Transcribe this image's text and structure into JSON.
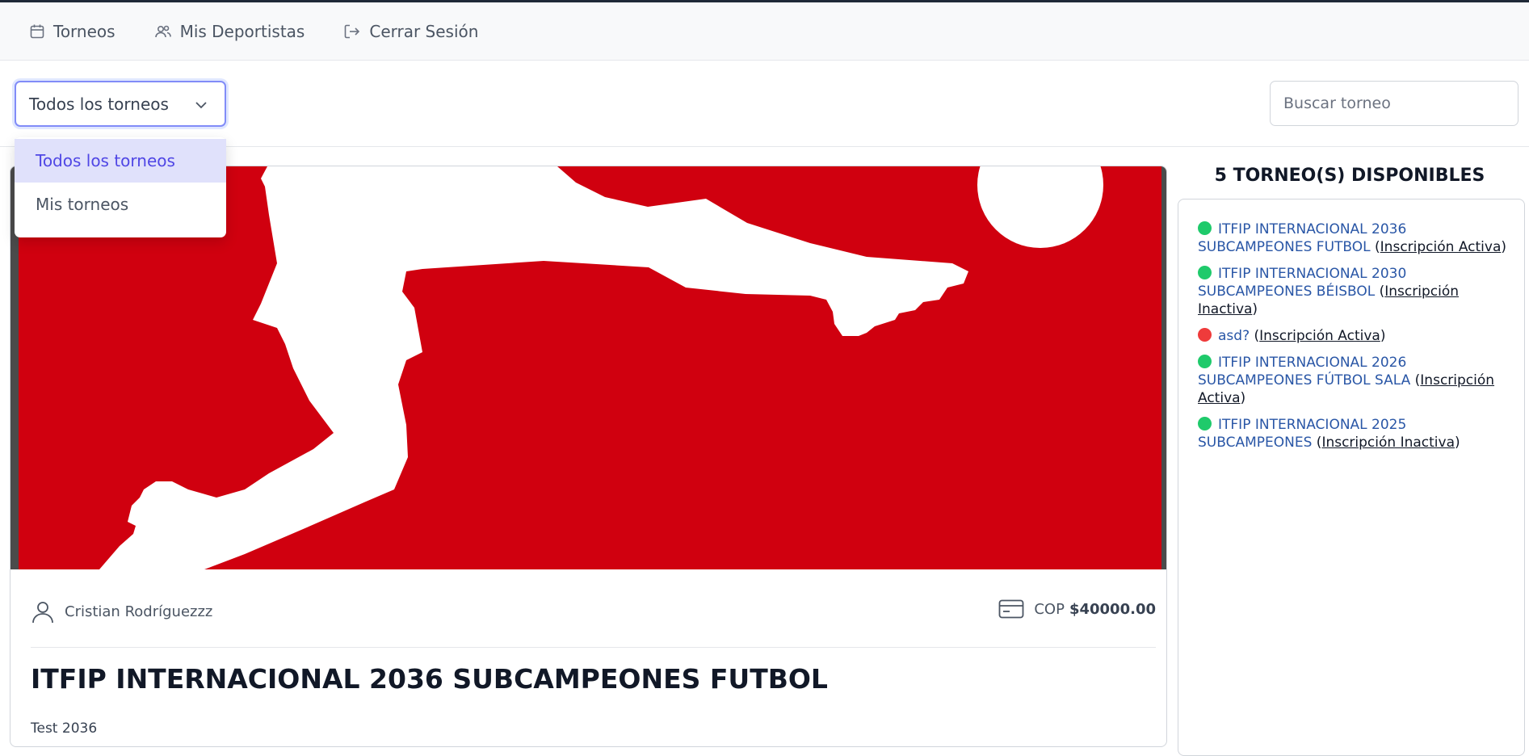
{
  "nav": {
    "items": [
      {
        "label": "Torneos",
        "icon": "calendar-icon"
      },
      {
        "label": "Mis Deportistas",
        "icon": "users-icon"
      },
      {
        "label": "Cerrar Sesión",
        "icon": "logout-icon"
      }
    ]
  },
  "filter": {
    "selected": "Todos los torneos",
    "options": [
      "Todos los torneos",
      "Mis torneos"
    ],
    "search_placeholder": "Buscar torneo"
  },
  "card": {
    "author": "Cristian Rodríguezzz",
    "currency": "COP",
    "price": "$40000.00",
    "title": "ITFIP INTERNACIONAL 2036 SUBCAMPEONES FUTBOL",
    "description": "Test 2036"
  },
  "sidebar": {
    "title": "5 TORNEO(S) DISPONIBLES",
    "colors": {
      "green": "#1fca6b",
      "red": "#ef3b3b"
    },
    "tournaments": [
      {
        "name": "ITFIP INTERNACIONAL 2036 SUBCAMPEONES FUTBOL",
        "status": "Inscripción Activa",
        "dot": "green"
      },
      {
        "name": "ITFIP INTERNACIONAL 2030 SUBCAMPEONES BÉISBOL",
        "status": "Inscripción Inactiva",
        "dot": "green"
      },
      {
        "name": "asd?",
        "status": "Inscripción Activa",
        "dot": "red"
      },
      {
        "name": "ITFIP INTERNACIONAL 2026 SUBCAMPEONES FÚTBOL SALA",
        "status": "Inscripción Activa",
        "dot": "green"
      },
      {
        "name": "ITFIP INTERNACIONAL 2025 SUBCAMPEONES",
        "status": "Inscripción Inactiva",
        "dot": "green"
      }
    ]
  },
  "banner": {
    "background": "#d0000f",
    "figure": "#ffffff"
  }
}
